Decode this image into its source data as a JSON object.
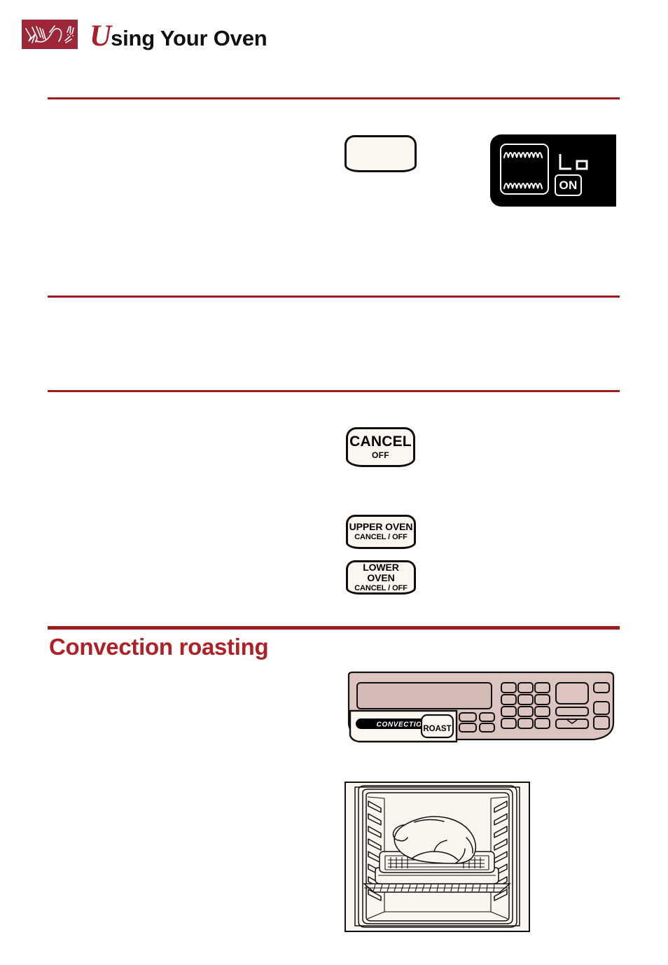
{
  "header": {
    "logo_icon": "brush-stroke-logo",
    "logo_color": "#9E2639",
    "title_initial": "U",
    "title_rest": "sing Your Oven",
    "title_full": "Using Your Oven"
  },
  "theme": {
    "accent_red": "#9E1B20",
    "heading_red": "#B02027",
    "key_face": "#FBF7F0",
    "panel_face": "#DCC5C0",
    "oven_face": "#FAF5EE",
    "lcd_background": "#000000"
  },
  "rules": [
    {
      "name": "rule-top",
      "weight": "thin"
    },
    {
      "name": "rule-second",
      "weight": "thin"
    },
    {
      "name": "rule-third",
      "weight": "thin"
    },
    {
      "name": "rule-section",
      "weight": "thick"
    }
  ],
  "keys": {
    "blank": {
      "label": ""
    },
    "cancel": {
      "main": "CANCEL",
      "sub": "OFF"
    },
    "upper_oven": {
      "main": "UPPER OVEN",
      "sub": "CANCEL / OFF"
    },
    "lower_oven": {
      "main": "LOWER OVEN",
      "sub": "CANCEL / OFF"
    }
  },
  "lcd": {
    "broil_icon": "broil-element-icon",
    "level": "Lo",
    "status": "ON"
  },
  "section": {
    "heading": "Convection roasting"
  },
  "control_panel": {
    "callout_label": "CONVECTION",
    "callout_button": "ROAST",
    "display_icon": "oven-display-panel",
    "keypad_icon": "numeric-keypad"
  },
  "oven_illustration": {
    "icon": "oven-cavity-with-roast-illustration",
    "description": "Oven interior with roast on a roasting pan set on a rack"
  }
}
